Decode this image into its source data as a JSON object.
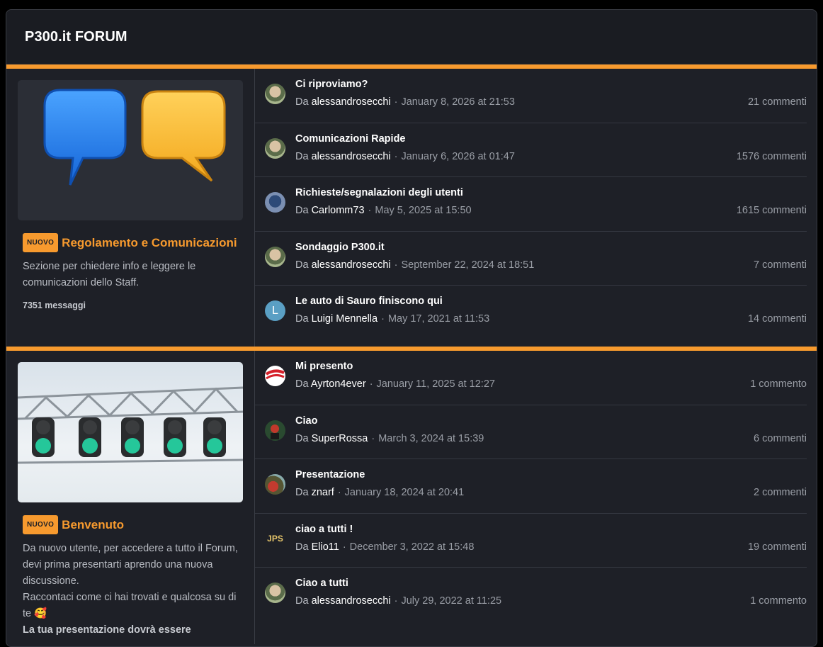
{
  "forum": {
    "title": "P300.it FORUM"
  },
  "categories": [
    {
      "badge": "NUOVO",
      "title": "Regolamento e Comunicazioni",
      "description": "Sezione per chiedere info e leggere le comunicazioni dello Staff.",
      "count": "7351 messaggi",
      "image": "speech-bubbles-image",
      "topics": [
        {
          "title": "Ci riproviamo?",
          "prefix": "Da",
          "author": "alessandrosecchi",
          "date": "January 8, 2026 at 21:53",
          "comments": "21 commenti",
          "avatar": "photo"
        },
        {
          "title": "Comunicazioni Rapide",
          "prefix": "Da",
          "author": "alessandrosecchi",
          "date": "January 6, 2026 at 01:47",
          "comments": "1576 commenti",
          "avatar": "photo"
        },
        {
          "title": "Richieste/segnalazioni degli utenti",
          "prefix": "Da",
          "author": "Carlomm73",
          "date": "May 5, 2025 at 15:50",
          "comments": "1615 commenti",
          "avatar": "photo2"
        },
        {
          "title": "Sondaggio P300.it",
          "prefix": "Da",
          "author": "alessandrosecchi",
          "date": "September 22, 2024 at 18:51",
          "comments": "7 commenti",
          "avatar": "photo"
        },
        {
          "title": "Le auto di Sauro finiscono qui",
          "prefix": "Da",
          "author": "Luigi Mennella",
          "date": "May 17, 2021 at 11:53",
          "comments": "14 commenti",
          "avatar": "letter",
          "avatar_letter": "L"
        }
      ]
    },
    {
      "badge": "NUOVO",
      "title": "Benvenuto",
      "description": "Da nuovo utente, per accedere a tutto il Forum, devi prima presentarti aprendo una nuova discussione.",
      "description2": "Raccontaci come ci hai trovati e qualcosa su di te 🥰",
      "description3": "La tua presentazione dovrà essere",
      "image": "traffic-lights-image",
      "topics": [
        {
          "title": "Mi presento",
          "prefix": "Da",
          "author": "Ayrton4ever",
          "date": "January 11, 2025 at 12:27",
          "comments": "1 commento",
          "avatar": "red"
        },
        {
          "title": "Ciao",
          "prefix": "Da",
          "author": "SuperRossa",
          "date": "March 3, 2024 at 15:39",
          "comments": "6 commenti",
          "avatar": "dark"
        },
        {
          "title": "Presentazione",
          "prefix": "Da",
          "author": "znarf",
          "date": "January 18, 2024 at 20:41",
          "comments": "2 commenti",
          "avatar": "car"
        },
        {
          "title": "ciao a tutti !",
          "prefix": "Da",
          "author": "Elio11",
          "date": "December 3, 2022 at 15:48",
          "comments": "19 commenti",
          "avatar": "jps",
          "avatar_letter": "JPS"
        },
        {
          "title": "Ciao a tutti",
          "prefix": "Da",
          "author": "alessandrosecchi",
          "date": "July 29, 2022 at 11:25",
          "comments": "1 commento",
          "avatar": "photo"
        }
      ]
    }
  ],
  "colors": {
    "accent": "#f79a2e",
    "background": "#1e2027",
    "text": "#ffffff",
    "muted": "#9a9ea6"
  }
}
